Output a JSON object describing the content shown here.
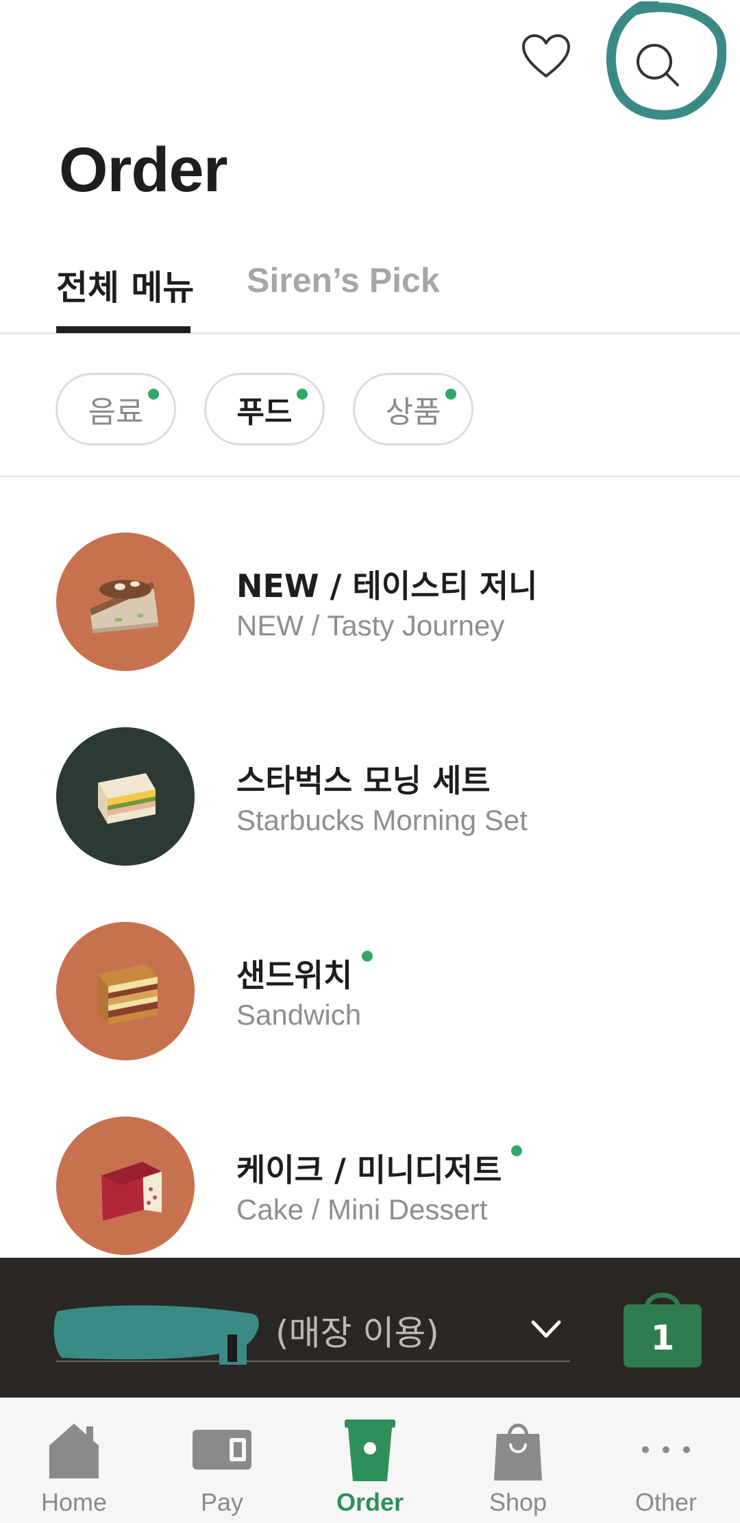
{
  "header": {
    "title": "Order",
    "favorites_icon": "heart-icon",
    "search_icon": "search-icon"
  },
  "tabs": [
    {
      "label": "전체 메뉴",
      "active": true
    },
    {
      "label": "Siren’s Pick",
      "active": false
    }
  ],
  "categories": [
    {
      "label": "음료",
      "active": false,
      "new_dot": true
    },
    {
      "label": "푸드",
      "active": true,
      "new_dot": true
    },
    {
      "label": "상품",
      "active": false,
      "new_dot": true
    }
  ],
  "menu": [
    {
      "name_ko": "NEW / 테이스티 저니",
      "name_en": "NEW / Tasty Journey",
      "new_dot": false,
      "thumb_color": "#c8714e",
      "image": "cake-slice"
    },
    {
      "name_ko": "스타벅스 모닝 세트",
      "name_en": "Starbucks Morning Set",
      "new_dot": false,
      "thumb_color": "#2c3a33",
      "image": "sandwich"
    },
    {
      "name_ko": "샌드위치",
      "name_en": "Sandwich",
      "new_dot": true,
      "thumb_color": "#c8714e",
      "image": "panini"
    },
    {
      "name_ko": "케이크 / 미니디저트",
      "name_en": "Cake / Mini Dessert",
      "new_dot": true,
      "thumb_color": "#c8714e",
      "image": "red-velvet-cake"
    }
  ],
  "store_bar": {
    "store_label": "(매장 이용)",
    "chevron_icon": "chevron-down-icon",
    "cart_count": "1",
    "cart_icon": "shopping-bag-icon"
  },
  "nav": [
    {
      "label": "Home",
      "icon": "home-icon",
      "active": false
    },
    {
      "label": "Pay",
      "icon": "wallet-icon",
      "active": false
    },
    {
      "label": "Order",
      "icon": "cup-icon",
      "active": true
    },
    {
      "label": "Shop",
      "icon": "shopping-bag-icon",
      "active": false
    },
    {
      "label": "Other",
      "icon": "more-icon",
      "active": false
    }
  ],
  "colors": {
    "accent_green": "#2fa866",
    "nav_active": "#2f8f5a",
    "cart_green": "#2f7d4e",
    "store_bar_bg": "#2a2724",
    "annotation_teal": "#3a8a86"
  }
}
